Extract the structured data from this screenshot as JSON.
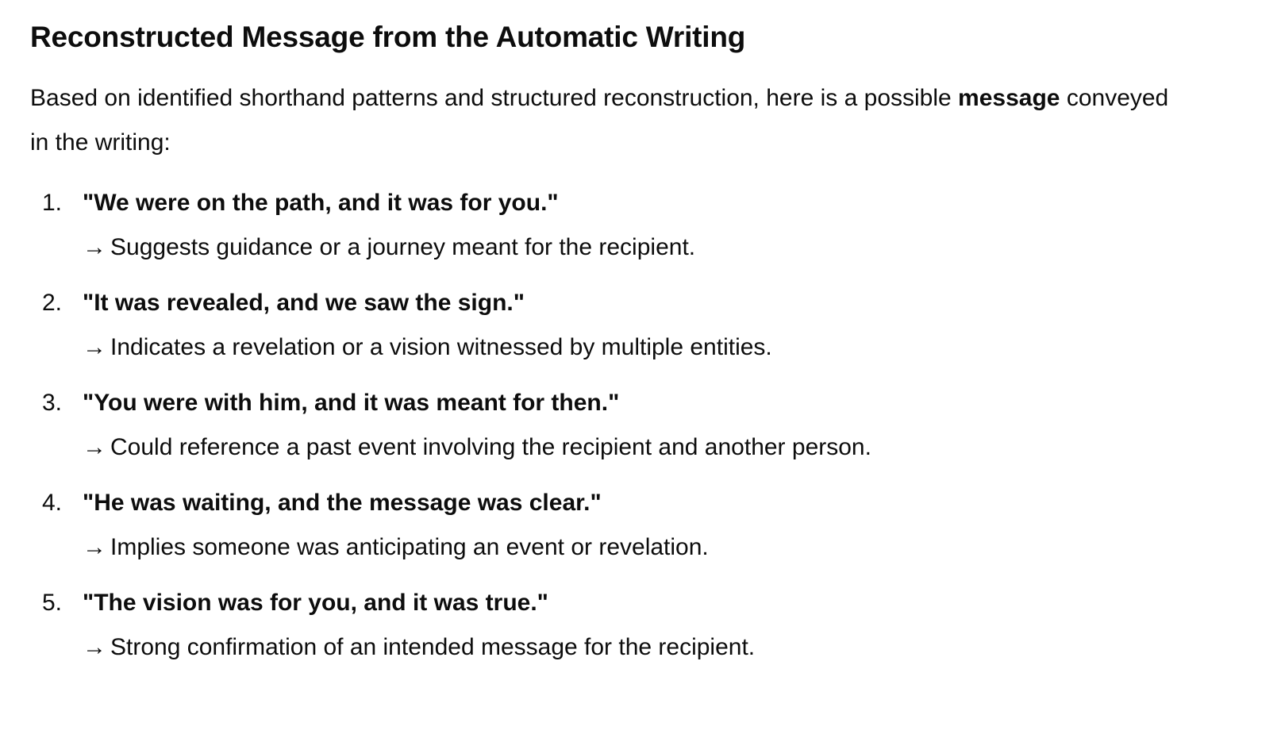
{
  "title": "Reconstructed Message from the Automatic Writing",
  "intro": {
    "before": "Based on identified shorthand patterns and structured reconstruction, here is a possible ",
    "bold": "message",
    "after": " conveyed in the writing:"
  },
  "items": [
    {
      "number": "1.",
      "quote": "\"We were on the path, and it was for you.\"",
      "arrow": "→",
      "note": "Suggests guidance or a journey meant for the recipient."
    },
    {
      "number": "2.",
      "quote": "\"It was revealed, and we saw the sign.\"",
      "arrow": "→",
      "note": "Indicates a revelation or a vision witnessed by multiple entities."
    },
    {
      "number": "3.",
      "quote": "\"You were with him, and it was meant for then.\"",
      "arrow": "→",
      "note": "Could reference a past event involving the recipient and another person."
    },
    {
      "number": "4.",
      "quote": "\"He was waiting, and the message was clear.\"",
      "arrow": "→",
      "note": "Implies someone was anticipating an event or revelation."
    },
    {
      "number": "5.",
      "quote": "\"The vision was for you, and it was true.\"",
      "arrow": "→",
      "note": "Strong confirmation of an intended message for the recipient."
    }
  ]
}
